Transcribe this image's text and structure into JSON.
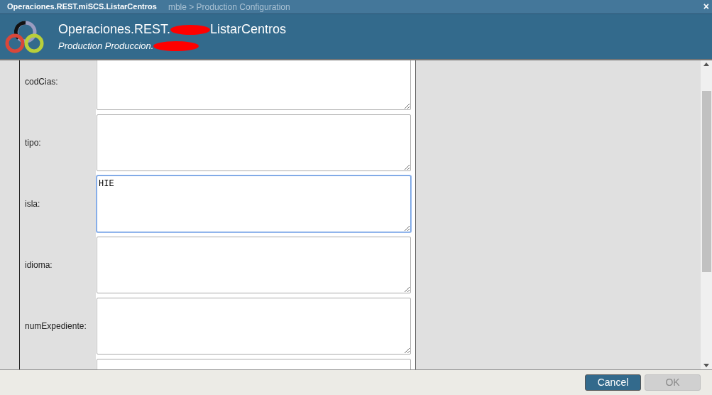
{
  "window": {
    "title": "Operaciones.REST.miSCS.ListarCentros",
    "background_text": "mble > Production Configuration",
    "close": "×"
  },
  "header": {
    "title_start": "Operaciones.REST.",
    "title_end": "ListarCentros",
    "subtitle": "Production Produccion."
  },
  "fields": [
    {
      "label": "codCias:",
      "focused": false
    },
    {
      "label": "tipo:",
      "focused": false
    },
    {
      "label": "isla:",
      "value": "HIE",
      "focused": true
    },
    {
      "label": "idioma:",
      "focused": false
    },
    {
      "label": "numExpediente:",
      "focused": false
    },
    {
      "focused": false
    }
  ],
  "buttons": [
    {
      "label": "Cancel",
      "disabled": false
    },
    {
      "label": "OK",
      "disabled": true
    }
  ]
}
